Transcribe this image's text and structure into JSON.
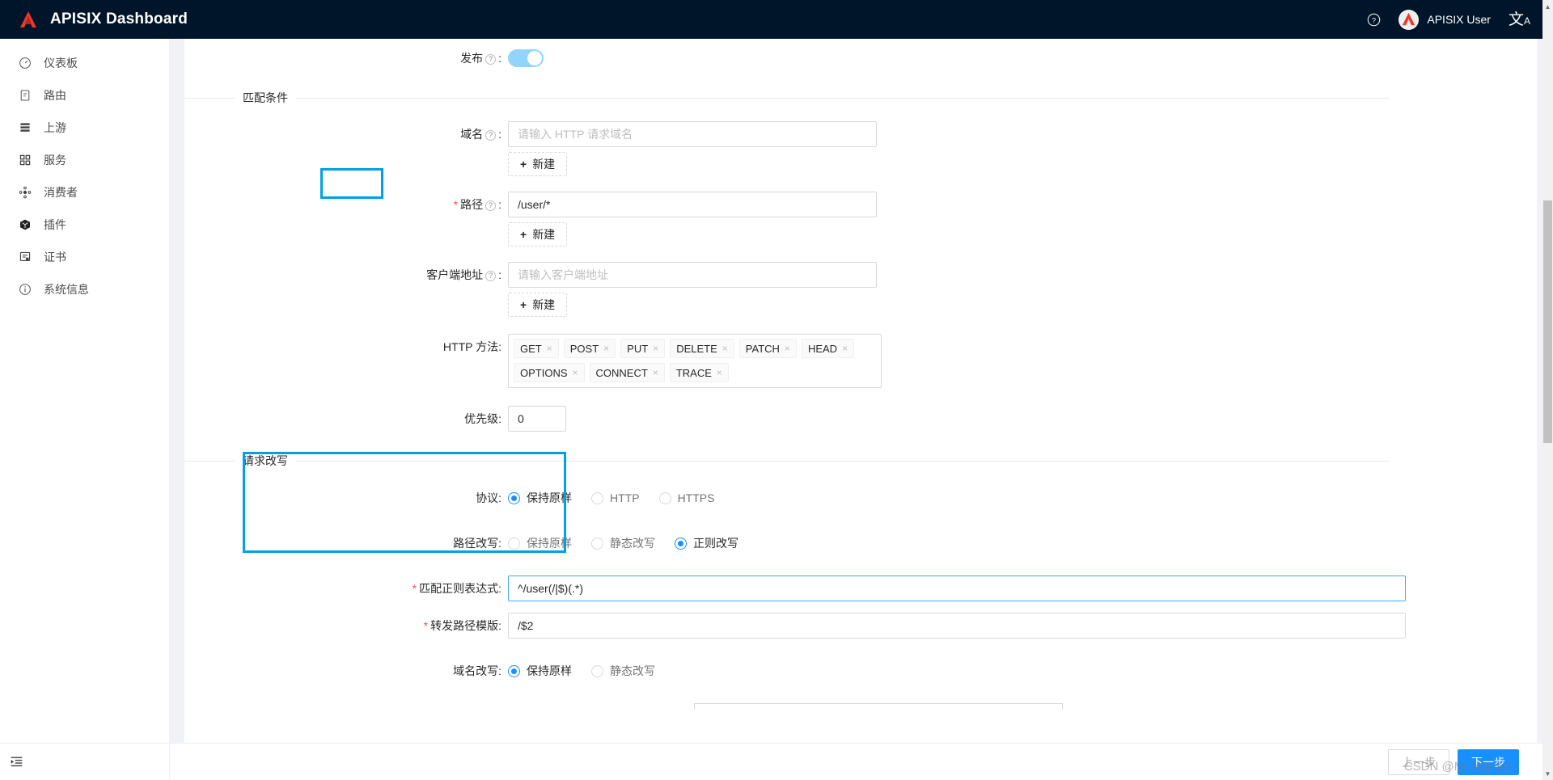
{
  "header": {
    "title": "APISIX Dashboard",
    "help_icon": "question-circle-icon",
    "user_name": "APISIX User",
    "lang_icon": "translate-icon"
  },
  "sidebar": {
    "items": [
      {
        "label": "仪表板",
        "icon": "dashboard-icon"
      },
      {
        "label": "路由",
        "icon": "route-icon"
      },
      {
        "label": "上游",
        "icon": "upstream-icon"
      },
      {
        "label": "服务",
        "icon": "service-icon"
      },
      {
        "label": "消费者",
        "icon": "consumer-icon"
      },
      {
        "label": "插件",
        "icon": "plugin-icon"
      },
      {
        "label": "证书",
        "icon": "certificate-icon"
      },
      {
        "label": "系统信息",
        "icon": "info-icon"
      }
    ],
    "collapse_icon": "menu-fold-icon"
  },
  "form": {
    "publish": {
      "label": "发布",
      "enabled": true
    },
    "match_section": {
      "title": "匹配条件"
    },
    "hosts": {
      "label": "域名",
      "value": "",
      "placeholder": "请输入 HTTP 请求域名",
      "add_label": "新建"
    },
    "paths": {
      "label": "路径",
      "required": true,
      "value": "/user/*",
      "add_label": "新建"
    },
    "remote_addrs": {
      "label": "客户端地址",
      "value": "",
      "placeholder": "请输入客户端地址",
      "add_label": "新建"
    },
    "methods": {
      "label": "HTTP 方法",
      "tags": [
        "GET",
        "POST",
        "PUT",
        "DELETE",
        "PATCH",
        "HEAD",
        "OPTIONS",
        "CONNECT",
        "TRACE"
      ]
    },
    "priority": {
      "label": "优先级",
      "value": "0"
    },
    "rewrite_section": {
      "title": "请求改写"
    },
    "scheme": {
      "label": "协议",
      "options": [
        "保持原样",
        "HTTP",
        "HTTPS"
      ],
      "selected": 0
    },
    "path_rewrite": {
      "label": "路径改写",
      "options": [
        "保持原样",
        "静态改写",
        "正则改写"
      ],
      "selected": 2
    },
    "regex_match": {
      "label": "匹配正则表达式",
      "required": true,
      "value": "^/user(/|$)(.*)"
    },
    "regex_template": {
      "label": "转发路径模版",
      "required": true,
      "value": "/$2"
    },
    "host_rewrite": {
      "label": "域名改写",
      "options": [
        "保持原样",
        "静态改写"
      ],
      "selected": 0
    }
  },
  "footer": {
    "prev_label": "上一步",
    "next_label": "下一步"
  },
  "watermark": "CSDN @Mr-Wanter",
  "colors": {
    "header_bg": "#001529",
    "primary": "#1890ff",
    "highlight": "#00a0e9",
    "required": "#ff4d4f"
  }
}
